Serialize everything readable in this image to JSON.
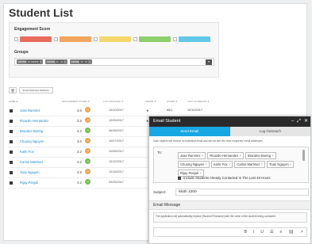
{
  "page": {
    "title": "Student List"
  },
  "engagement": {
    "label": "Engagement Score",
    "chips": [
      {
        "text": "",
        "color": "#e86b5e"
      },
      {
        "text": "",
        "color": "#f1a65d"
      },
      {
        "text": "",
        "color": "#f4d86c"
      },
      {
        "text": "",
        "color": "#8fce6b"
      },
      {
        "text": "",
        "color": "#63c8e8"
      }
    ]
  },
  "groups": {
    "label": "Groups",
    "tags": [
      {
        "prefix": "GRADE",
        "value": "10 GRADE"
      },
      {
        "prefix": "GRADE",
        "value": "11 - 12"
      },
      {
        "prefix": "GRADE",
        "value": "12 - 12"
      }
    ]
  },
  "toolbar": {
    "email_selected_label": "Email Selected Students"
  },
  "table": {
    "columns": [
      "NAME ▲",
      "ENGAGEMENT SCORE ▼",
      "LAST ENGAGED ▼",
      "GRADE ▼",
      "SCORE ▼",
      "LAST OUTREACH ▼"
    ],
    "rows": [
      {
        "name": "Jose Ramirez",
        "score": "3.6",
        "dot_color": "#f0a24a",
        "date": "10/10/2017",
        "extra": "★",
        "extra2": "65/1",
        "extra3": "10/10/2017"
      },
      {
        "name": "Ricardo Hernandez",
        "score": "3.5",
        "dot_color": "#f0a24a",
        "date": "10/09/2017",
        "extra": "★",
        "extra2": "",
        "extra3": ""
      },
      {
        "name": "Brandon Boring",
        "score": "4.2",
        "dot_color": "#6fbf4b",
        "date": "06/28/2017",
        "extra": "",
        "extra2": "",
        "extra3": ""
      },
      {
        "name": "Chuong Nguyen",
        "score": "3.6",
        "dot_color": "#f0a24a",
        "date": "10/07/2017",
        "extra": "",
        "extra2": "",
        "extra3": ""
      },
      {
        "name": "Kiefe Fox",
        "score": "3.2",
        "dot_color": "#f0a24a",
        "date": "10/05/2017",
        "extra": "",
        "extra2": "",
        "extra3": ""
      },
      {
        "name": "Carlos Martinez",
        "score": "4.2",
        "dot_color": "#6fbf4b",
        "date": "10/12/2017",
        "extra": "",
        "extra2": "",
        "extra3": ""
      },
      {
        "name": "Toan Nguyen",
        "score": "3.9",
        "dot_color": "#f0a24a",
        "date": "10/16/2017",
        "extra": "",
        "extra2": "",
        "extra3": ""
      },
      {
        "name": "Rijay Panjuli",
        "score": "4.2",
        "dot_color": "#6fbf4b",
        "date": "09/25/2017",
        "extra": "",
        "extra2": "",
        "extra3": ""
      }
    ]
  },
  "modal": {
    "title": "Email Student",
    "tabs": [
      "Send Email",
      "Log Outreach"
    ],
    "note": "Each student will receive an individual email and will not see the other recipients' email addresses.",
    "to_label": "To:",
    "recipients": [
      "Jose Ramirez",
      "Ricardo Hernandez",
      "Brandon Boring",
      "Chuong Nguyen",
      "Kiefe Fox",
      "Carlos Martinez",
      "Toan Nguyen",
      "Rijay Panjuli"
    ],
    "include_label": "Include Students Already Contacted In The Last 48 Hours",
    "subject_label": "Subject:",
    "subject_value": "Math 1000",
    "message_label": "Email Message",
    "message_note": "The application will automatically replace [Student Firstname] with the name of the student being contacted.",
    "editor_tools": [
      "B",
      "I",
      "U",
      "☰",
      "≡",
      "⛓",
      "↗"
    ]
  }
}
